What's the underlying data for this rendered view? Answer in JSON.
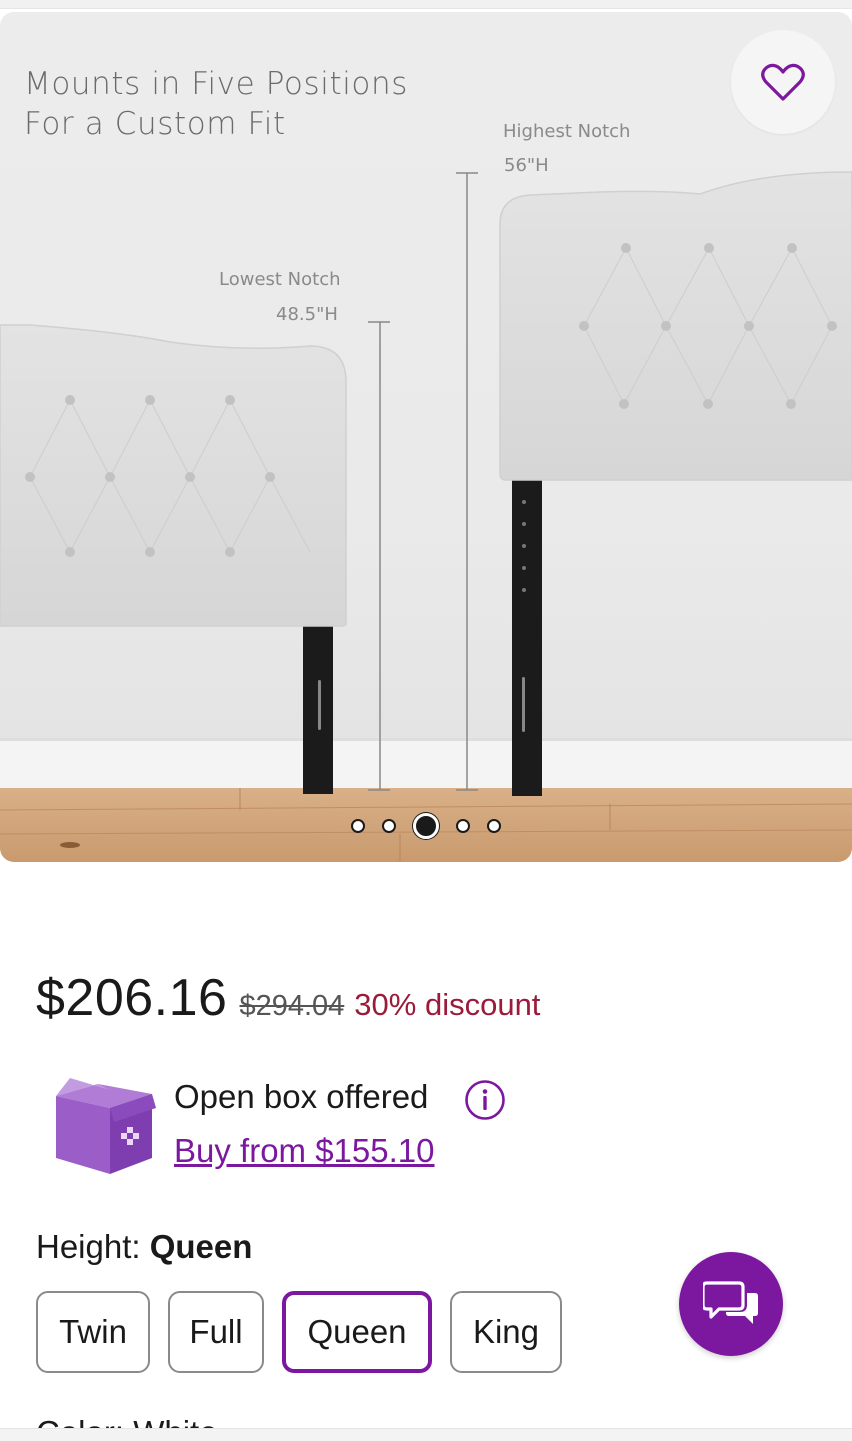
{
  "hero": {
    "caption_line1": "Mounts in Five Positions",
    "caption_line2": "For a Custom Fit",
    "lowest_notch_label": "Lowest Notch",
    "lowest_notch_value": "48.5\"H",
    "highest_notch_label": "Highest Notch",
    "highest_notch_value": "56\"H",
    "favorite_icon": "heart-icon",
    "carousel": {
      "count": 5,
      "active_index": 3
    }
  },
  "pricing": {
    "price": "$206.16",
    "original_price": "$294.04",
    "discount": "30% discount",
    "discount_color": "#9b1b3a"
  },
  "open_box": {
    "text": "Open box offered",
    "link": "Buy from $155.10",
    "icon": "open-box-icon",
    "info_icon": "info-icon"
  },
  "height": {
    "label": "Height:",
    "selected": "Queen",
    "options": [
      "Twin",
      "Full",
      "Queen",
      "King"
    ]
  },
  "next_section_partial": "Color: White",
  "chat_icon": "chat-icon",
  "accent_color": "#7b189f"
}
